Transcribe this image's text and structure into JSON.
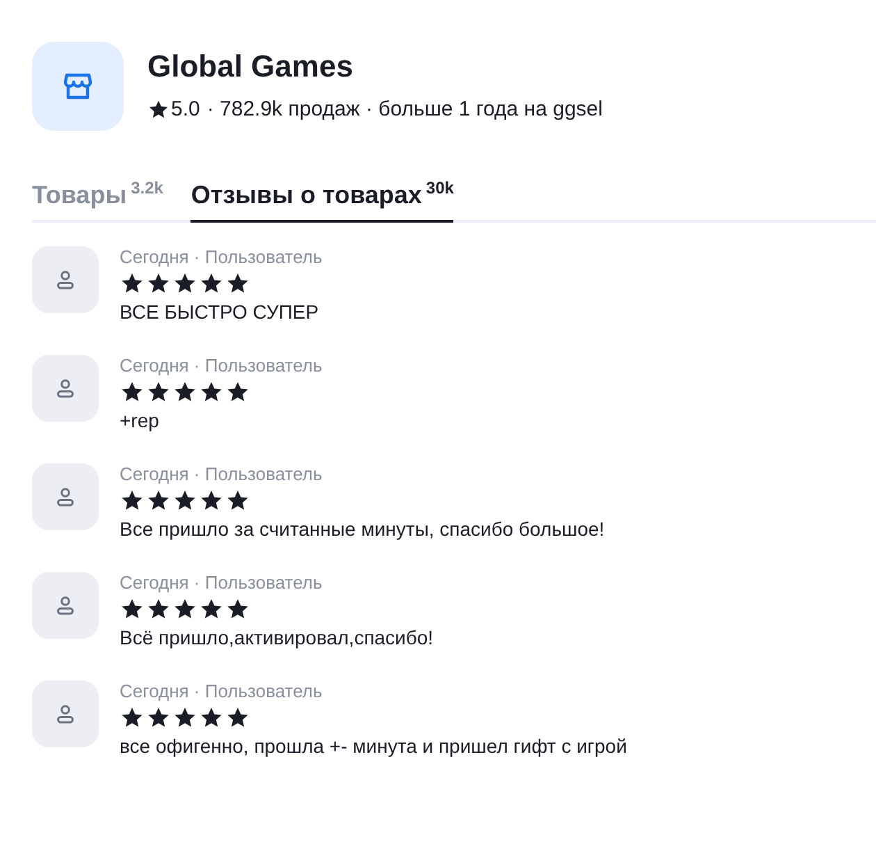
{
  "shop": {
    "name": "Global Games",
    "rating": "5.0",
    "stats": "· 782.9k продаж · больше 1 года на ggsel"
  },
  "tabs": [
    {
      "label": "Товары",
      "count": "3.2k",
      "selected": false
    },
    {
      "label": "Отзывы о товарах",
      "count": "30k",
      "selected": true
    }
  ],
  "reviews": [
    {
      "meta": "Сегодня · Пользователь",
      "stars": 5,
      "text": "ВСЕ БЫСТРО СУПЕР"
    },
    {
      "meta": "Сегодня · Пользователь",
      "stars": 5,
      "text": "+rep"
    },
    {
      "meta": "Сегодня · Пользователь",
      "stars": 5,
      "text": "Все пришло за считанные минуты, спасибо большое!"
    },
    {
      "meta": "Сегодня · Пользователь",
      "stars": 5,
      "text": "Всё пришло,активировал,спасибо!"
    },
    {
      "meta": "Сегодня · Пользователь",
      "stars": 5,
      "text": "все офигенно, прошла +- минута и пришел гифт с игрой"
    }
  ]
}
